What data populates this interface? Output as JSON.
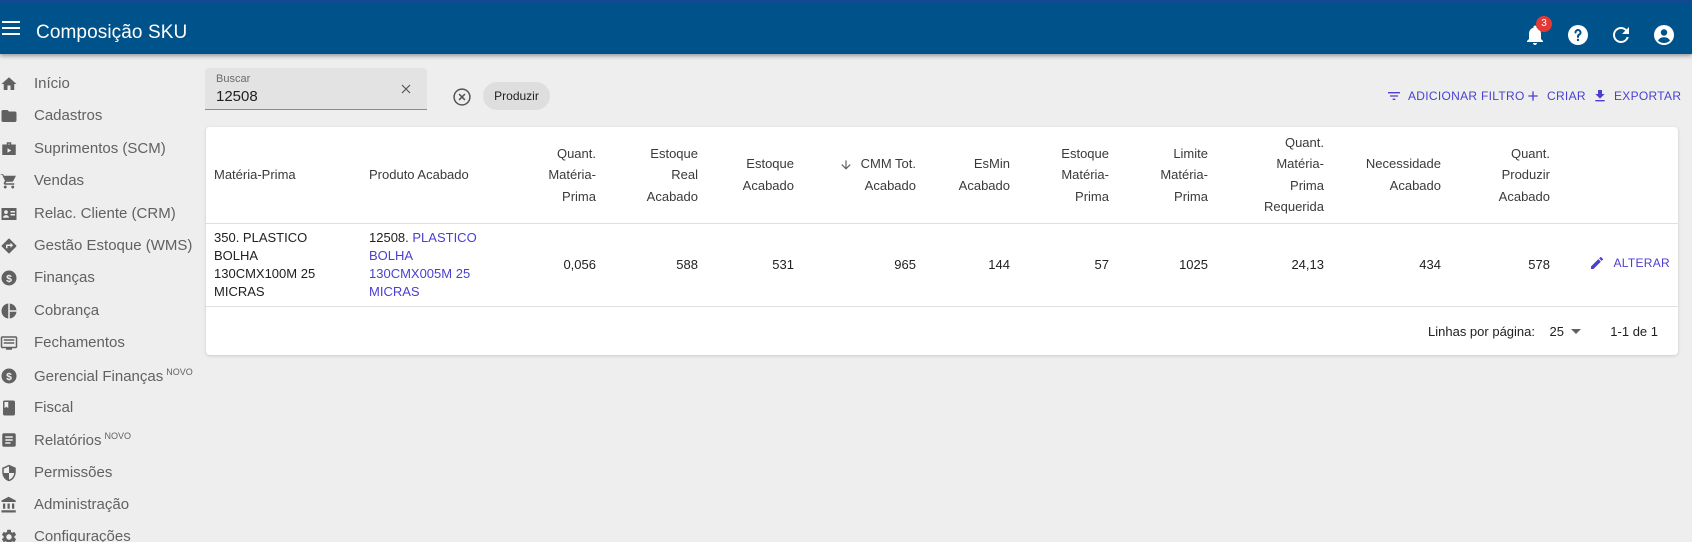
{
  "appbar": {
    "title": "Composição SKU",
    "notification_count": "3",
    "icons": [
      "menu-icon",
      "bell-icon",
      "help-icon",
      "refresh-icon",
      "account-icon"
    ],
    "color": "#00528a"
  },
  "sidebar": {
    "items": [
      {
        "label": "Início",
        "icon": "home-icon",
        "badge": ""
      },
      {
        "label": "Cadastros",
        "icon": "folder-icon",
        "badge": ""
      },
      {
        "label": "Suprimentos (SCM)",
        "icon": "supply-icon",
        "badge": ""
      },
      {
        "label": "Vendas",
        "icon": "cart-icon",
        "badge": ""
      },
      {
        "label": "Relac. Cliente (CRM)",
        "icon": "contact-card-icon",
        "badge": ""
      },
      {
        "label": "Gestão Estoque (WMS)",
        "icon": "directions-icon",
        "badge": ""
      },
      {
        "label": "Finanças",
        "icon": "dollar-icon",
        "badge": ""
      },
      {
        "label": "Cobrança",
        "icon": "pie-icon",
        "badge": ""
      },
      {
        "label": "Fechamentos",
        "icon": "list-monitor-icon",
        "badge": ""
      },
      {
        "label": "Gerencial Finanças",
        "icon": "dollar-icon",
        "badge": "NOVO"
      },
      {
        "label": "Fiscal",
        "icon": "book-icon",
        "badge": ""
      },
      {
        "label": "Relatórios",
        "icon": "report-icon",
        "badge": "NOVO"
      },
      {
        "label": "Permissões",
        "icon": "shield-icon",
        "badge": ""
      },
      {
        "label": "Administração",
        "icon": "bank-icon",
        "badge": ""
      },
      {
        "label": "Configurações",
        "icon": "gear-icon",
        "badge": ""
      }
    ]
  },
  "filters": {
    "search_label": "Buscar",
    "search_value": "12508",
    "chip_label": "Produzir"
  },
  "toolbar": {
    "add_filter": "ADICIONAR FILTRO",
    "create": "CRIAR",
    "export": "EXPORTAR",
    "accent": "#4a3fd0"
  },
  "table": {
    "headers": {
      "materia_prima": "Matéria-Prima",
      "produto_acabado": "Produto Acabado",
      "quant_mp": [
        "Quant.",
        "Matéria-",
        "Prima"
      ],
      "estoque_real": [
        "Estoque",
        "Real",
        "Acabado"
      ],
      "estoque_acabado": [
        "Estoque",
        "Acabado"
      ],
      "cmm": [
        "CMM Tot.",
        "Acabado"
      ],
      "esmin": [
        "EsMin",
        "Acabado"
      ],
      "estoque_mp": [
        "Estoque",
        "Matéria-",
        "Prima"
      ],
      "limite_mp": [
        "Limite",
        "Matéria-",
        "Prima"
      ],
      "quant_mp_req": [
        "Quant.",
        "Matéria-",
        "Prima",
        "Requerida"
      ],
      "necessidade": [
        "Necessidade",
        "Acabado"
      ],
      "quant_produzir": [
        "Quant.",
        "Produzir",
        "Acabado"
      ]
    },
    "rows": [
      {
        "materia_prima": [
          "350. PLASTICO",
          "BOLHA",
          "130CMX100M 25",
          "MICRAS"
        ],
        "produto_code": "12508.",
        "produto_link": [
          "PLASTICO",
          "BOLHA",
          "130CMX005M 25",
          "MICRAS"
        ],
        "quant_mp": "0,056",
        "estoque_real": "588",
        "estoque_acabado": "531",
        "cmm": "965",
        "esmin": "144",
        "estoque_mp": "57",
        "limite_mp": "1025",
        "quant_mp_req": "24,13",
        "necessidade": "434",
        "quant_produzir": "578",
        "action": "ALTERAR"
      }
    ]
  },
  "pagination": {
    "rows_per_page_label": "Linhas por página:",
    "rows_per_page": "25",
    "range": "1-1 de 1"
  }
}
